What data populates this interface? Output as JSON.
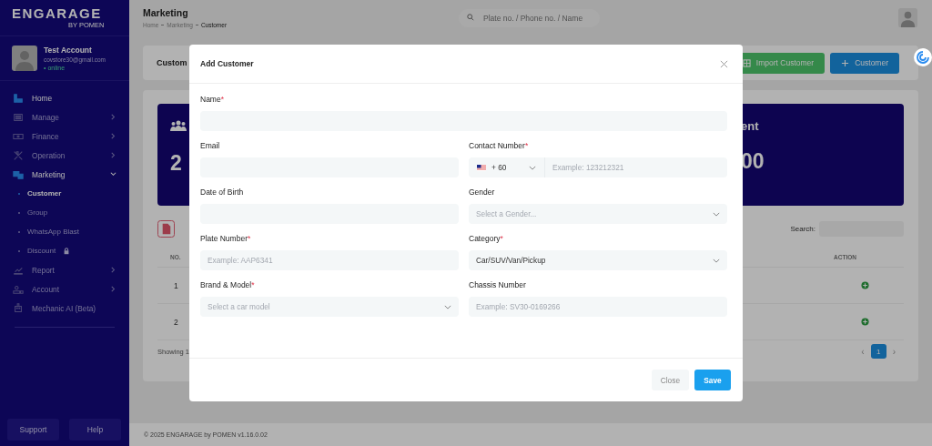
{
  "sidebar": {
    "logo": "ENGARAGE",
    "logo_sub": "BY POMEN",
    "profile": {
      "name": "Test Account",
      "email": "covstore30@gmail.com",
      "status": "• online"
    },
    "items": [
      {
        "label": "Home",
        "kind": "link",
        "selected": true
      },
      {
        "label": "Manage",
        "kind": "group",
        "selected": false,
        "expanded": false
      },
      {
        "label": "Finance",
        "kind": "group",
        "selected": false,
        "expanded": false
      },
      {
        "label": "Operation",
        "kind": "group",
        "selected": false,
        "expanded": false
      },
      {
        "label": "Marketing",
        "kind": "group",
        "selected": true,
        "expanded": true,
        "children": [
          {
            "label": "Customer",
            "selected": true,
            "locked": false
          },
          {
            "label": "Group",
            "selected": false,
            "locked": false
          },
          {
            "label": "WhatsApp Blast",
            "selected": false,
            "locked": false
          },
          {
            "label": "Discount",
            "selected": false,
            "locked": true
          }
        ]
      },
      {
        "label": "Report",
        "kind": "group",
        "selected": false,
        "expanded": false
      },
      {
        "label": "Account",
        "kind": "group",
        "selected": false,
        "expanded": false
      },
      {
        "label": "Mechanic AI (Beta)",
        "kind": "link",
        "selected": false
      }
    ],
    "buttons": [
      "Support",
      "Help"
    ]
  },
  "topbar": {
    "title": "Marketing",
    "breadcrumb": [
      "Home",
      "Marketing",
      "Customer"
    ],
    "search": {
      "placeholder": "Plate no. / Phone no. / Name"
    }
  },
  "page": {
    "title": "Custom",
    "buttons": [
      {
        "label": "Import Customer",
        "kind": "import"
      },
      {
        "label": "Customer",
        "kind": "add"
      }
    ],
    "stats": [
      {
        "value": "2"
      },
      {
        "title": "ent",
        "value": "00"
      }
    ],
    "table": {
      "search_label": "Search:",
      "columns": [
        "NO.",
        "ACTION"
      ],
      "rows": [
        {
          "no": "1"
        },
        {
          "no": "2"
        }
      ],
      "info": "Showing 1",
      "pagination": {
        "prev": "‹",
        "next": "›",
        "pages": [
          {
            "label": "1",
            "selected": true
          }
        ]
      }
    }
  },
  "footer": "© 2025  ENGARAGE by POMEN v1.16.0.02",
  "modal": {
    "title": "Add Customer",
    "fields": [
      {
        "label": "Name",
        "required_mark": "*",
        "kind": "text",
        "wide": true
      },
      {
        "label": "Email",
        "kind": "text"
      },
      {
        "label": "Contact Number",
        "required_mark": "*",
        "kind": "phone",
        "country_code": "+ 60",
        "placeholder": "Example: 123212321"
      },
      {
        "label": "Date of Birth",
        "kind": "text"
      },
      {
        "label": "Gender",
        "kind": "select",
        "placeholder": "Select a Gender..."
      },
      {
        "label": "Plate Number",
        "required_mark": "*",
        "kind": "text",
        "placeholder": "Example: AAP6341"
      },
      {
        "label": "Category",
        "required_mark": "*",
        "kind": "select",
        "value": "Car/SUV/Van/Pickup"
      },
      {
        "label": "Brand & Model",
        "required_mark": "*",
        "kind": "select",
        "placeholder": "Select a car model"
      },
      {
        "label": "Chassis Number",
        "kind": "text",
        "placeholder": "Example: SV30-0169266"
      }
    ],
    "buttons": [
      {
        "label": "Close",
        "kind": "secondary"
      },
      {
        "label": "Save",
        "kind": "primary"
      }
    ]
  }
}
